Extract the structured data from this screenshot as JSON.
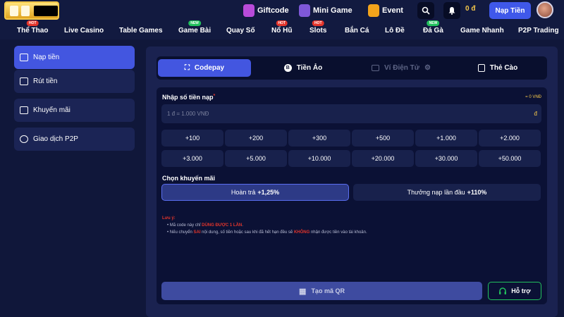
{
  "topbar": {
    "logo_text": "•",
    "links": [
      {
        "label": "Giftcode",
        "icon": "gift-icon",
        "color": "#b84bd9"
      },
      {
        "label": "Mini Game",
        "icon": "gamepad-icon",
        "color": "#7f58d8"
      },
      {
        "label": "Event",
        "icon": "fireworks-icon",
        "color": "#f2a31b"
      }
    ],
    "balance": "0 đ",
    "deposit_label": "Nạp Tiền"
  },
  "nav": [
    {
      "label": "Thể Thao",
      "badge": "HOT"
    },
    {
      "label": "Live Casino",
      "badge": ""
    },
    {
      "label": "Table Games",
      "badge": ""
    },
    {
      "label": "Game Bài",
      "badge": "NEW"
    },
    {
      "label": "Quay Số",
      "badge": ""
    },
    {
      "label": "Nổ Hũ",
      "badge": "HOT"
    },
    {
      "label": "Slots",
      "badge": "HOT"
    },
    {
      "label": "Bắn Cá",
      "badge": ""
    },
    {
      "label": "Lô Đề",
      "badge": ""
    },
    {
      "label": "Đá Gà",
      "badge": "NEW"
    },
    {
      "label": "Game Nhanh",
      "badge": ""
    },
    {
      "label": "P2P Trading",
      "badge": ""
    }
  ],
  "sidebar": [
    {
      "label": "Nạp tiền",
      "active": true,
      "icon": "wallet-icon"
    },
    {
      "label": "Rút tiền",
      "active": false,
      "icon": "withdraw-icon"
    },
    {
      "label": "Khuyến mãi",
      "active": false,
      "icon": "gift-icon"
    },
    {
      "label": "Giao dịch P2P",
      "active": false,
      "icon": "p2p-icon"
    }
  ],
  "tabs": [
    {
      "label": "Codepay",
      "state": "active",
      "icon": "codepay-icon"
    },
    {
      "label": "Tiền Ảo",
      "state": "normal",
      "icon": "bitcoin-icon"
    },
    {
      "label": "Ví Điện Tử",
      "state": "disabled",
      "icon": "ewallet-icon"
    },
    {
      "label": "Thẻ Cào",
      "state": "normal",
      "icon": "card-icon"
    }
  ],
  "form": {
    "amount_label": "Nhập số tiền nạp",
    "required_mark": "*",
    "unit_value": "= 0 VNĐ",
    "placeholder": "1 đ = 1.000 VNĐ",
    "currency": "đ",
    "quick_amounts": [
      "+100",
      "+200",
      "+300",
      "+500",
      "+1.000",
      "+2.000",
      "+3.000",
      "+5.000",
      "+10.000",
      "+20.000",
      "+30.000",
      "+50.000"
    ],
    "promo_label": "Chọn khuyến mãi",
    "promos": [
      {
        "text": "Hoàn trả",
        "value": "+1,25%",
        "active": true
      },
      {
        "text": "Thưởng nạp lần đầu",
        "value": "+110%",
        "active": false
      }
    ],
    "notes_title": "Lưu ý:",
    "note_1": [
      "Mã code này chỉ ",
      "DÙNG ĐƯỢC 1 LẦN",
      "."
    ],
    "note_2": [
      "Nếu chuyển ",
      "SAI",
      " nội dung, số tiền hoặc sau khi đã hết hạn đều sẽ ",
      "KHÔNG",
      " nhận được tiền vào tài khoản."
    ],
    "qr_label": "Tạo mã QR",
    "help_label": "Hỗ trợ"
  }
}
